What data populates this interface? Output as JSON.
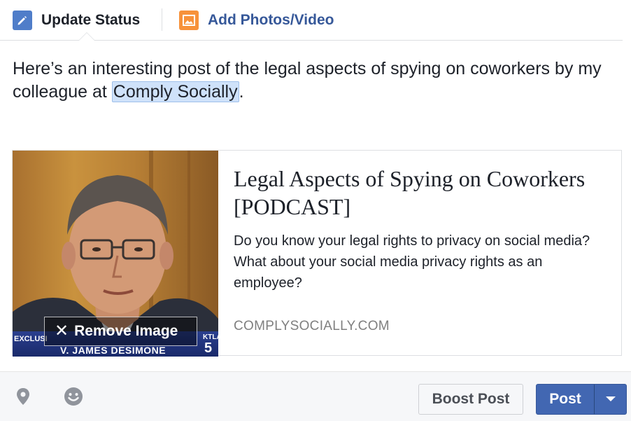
{
  "tabs": {
    "update_status": {
      "label": "Update Status",
      "icon": "pencil-icon"
    },
    "add_photos": {
      "label": "Add Photos/Video",
      "icon": "photo-icon"
    }
  },
  "status": {
    "text_before": "Here’s an interesting post of the legal aspects of spying on coworkers by my colleague at ",
    "mention": "Comply Socially",
    "text_after": "."
  },
  "link_preview": {
    "title": "Legal Aspects of Spying on Coworkers [PODCAST]",
    "description": "Do you know your legal rights to privacy on social media? What about your social media privacy rights as an employee?",
    "domain": "COMPLYSOCIALLY.COM",
    "thumbnail": {
      "remove_label": "Remove Image",
      "remove_icon": "close-icon",
      "overlay_left": "EXCLUSI",
      "overlay_right": "KTLA",
      "nameplate": "V. JAMES DESIMONE",
      "channel": "5"
    }
  },
  "footer": {
    "location_icon": "location-pin-icon",
    "emoji_icon": "smiley-icon",
    "boost_label": "Boost Post",
    "post_label": "Post",
    "post_menu_icon": "chevron-down-icon"
  },
  "colors": {
    "brand_blue": "#4267b2",
    "link_blue": "#365899",
    "mention_bg": "#cfe2fa",
    "footer_bg": "#f6f7f9"
  }
}
